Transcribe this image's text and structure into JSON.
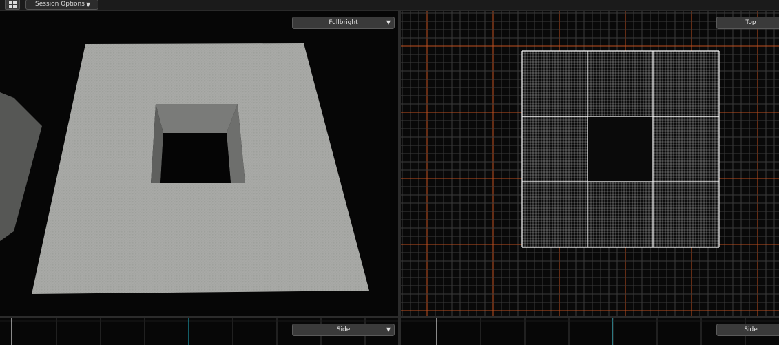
{
  "toolbar": {
    "layout_icon": "grid-layout-icon",
    "session_options_label": "Session Options",
    "session_options_arrow": "▼"
  },
  "viewports": {
    "perspective": {
      "mode_label": "Fullbright",
      "arrow": "▼"
    },
    "top": {
      "view_label": "Top"
    },
    "side_left": {
      "view_label": "Side",
      "arrow": "▼"
    },
    "side_right": {
      "view_label": "Side"
    }
  },
  "colors": {
    "background": "#0c0c0c",
    "grid_line": "#3a3a3a",
    "grid_major": "#c0501e",
    "mesh_wire": "#ffffff",
    "mesh_surface": "#a6a7a4",
    "axis_line": "#1fb5c8"
  }
}
